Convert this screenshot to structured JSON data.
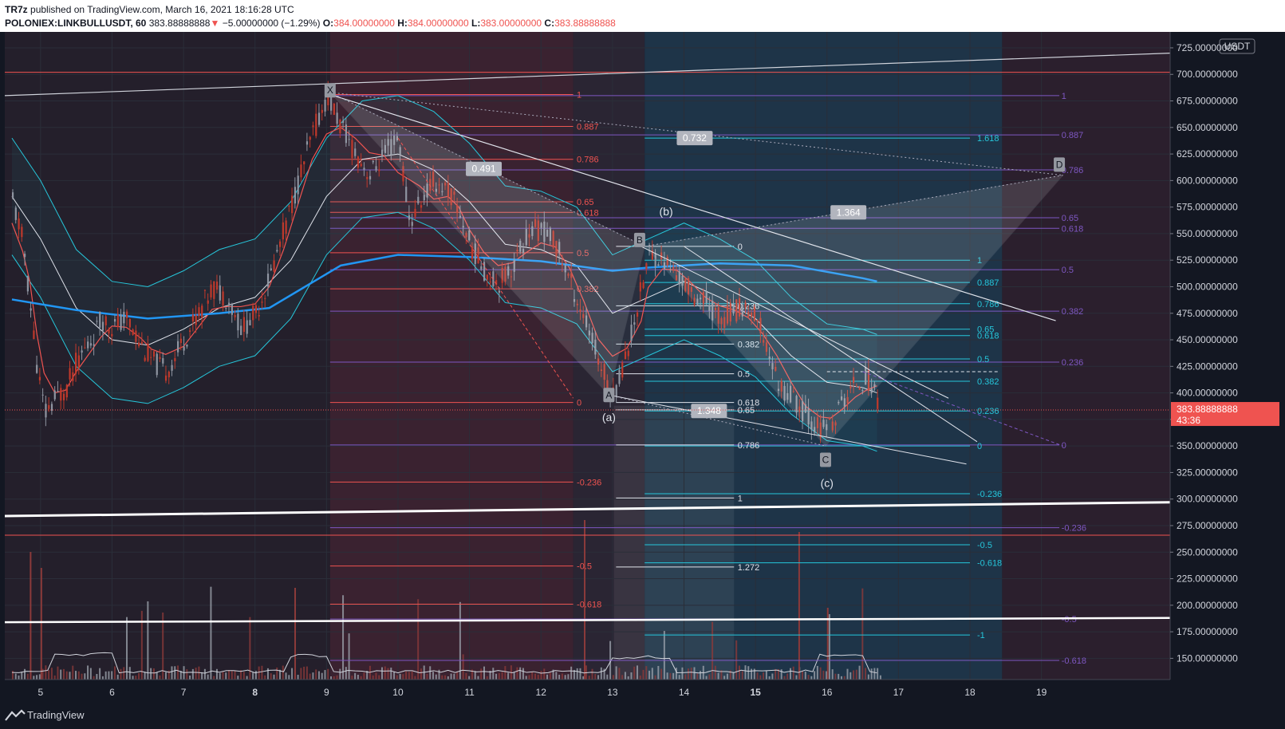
{
  "header": {
    "author": "TR7z",
    "published_text": "published on TradingView.com, March 16, 2021 18:16:28 UTC",
    "symbol": "POLONIEX:LINKBULLUSDT, 60",
    "last": "383.88888888",
    "change_arrow": "▼",
    "change": "−5.00000000 (−1.29%)",
    "o_label": "O:",
    "o": "384.00000000",
    "h_label": "H:",
    "h": "384.00000000",
    "l_label": "L:",
    "l": "383.00000000",
    "c_label": "C:",
    "c": "383.88888888"
  },
  "footer": {
    "brand": "TradingView"
  },
  "colors": {
    "bg": "#131722",
    "up": "#8f95a1",
    "down": "#c0392b",
    "ma": "#2196f3",
    "bb": "#26c6da",
    "red_fib": "#ef5350",
    "purple_fib": "#7e57c2",
    "cyan_fib": "#26c6da"
  },
  "chart_data": {
    "type": "candlestick",
    "currency": "USDT",
    "ylim": [
      130,
      740
    ],
    "y_ticks": [
      "725.00000000",
      "700.00000000",
      "675.00000000",
      "650.00000000",
      "625.00000000",
      "600.00000000",
      "575.00000000",
      "550.00000000",
      "525.00000000",
      "500.00000000",
      "475.00000000",
      "450.00000000",
      "425.00000000",
      "400.00000000",
      "375.00000000",
      "350.00000000",
      "325.00000000",
      "300.00000000",
      "275.00000000",
      "250.00000000",
      "225.00000000",
      "200.00000000",
      "175.00000000",
      "150.00000000"
    ],
    "x_ticks": [
      "5",
      "6",
      "7",
      "8",
      "9",
      "10",
      "11",
      "12",
      "13",
      "14",
      "15",
      "16",
      "17",
      "18",
      "19"
    ],
    "x_tick_bold": [
      "8",
      "15"
    ],
    "last_price": "383.88888888",
    "countdown": "43:36",
    "price_path": [
      [
        4.6,
        580
      ],
      [
        4.75,
        540
      ],
      [
        4.85,
        480
      ],
      [
        4.95,
        420
      ],
      [
        5.05,
        380
      ],
      [
        5.2,
        395
      ],
      [
        5.35,
        405
      ],
      [
        5.5,
        430
      ],
      [
        5.7,
        450
      ],
      [
        5.85,
        470
      ],
      [
        6.0,
        462
      ],
      [
        6.2,
        470
      ],
      [
        6.4,
        445
      ],
      [
        6.55,
        430
      ],
      [
        6.75,
        420
      ],
      [
        7.0,
        450
      ],
      [
        7.2,
        475
      ],
      [
        7.4,
        500
      ],
      [
        7.6,
        490
      ],
      [
        7.8,
        460
      ],
      [
        8.0,
        475
      ],
      [
        8.2,
        510
      ],
      [
        8.4,
        555
      ],
      [
        8.6,
        600
      ],
      [
        8.8,
        645
      ],
      [
        9.0,
        680
      ],
      [
        9.2,
        650
      ],
      [
        9.4,
        625
      ],
      [
        9.6,
        605
      ],
      [
        9.8,
        625
      ],
      [
        10.0,
        640
      ],
      [
        10.15,
        560
      ],
      [
        10.3,
        580
      ],
      [
        10.5,
        600
      ],
      [
        10.7,
        590
      ],
      [
        10.85,
        570
      ],
      [
        11.0,
        540
      ],
      [
        11.2,
        515
      ],
      [
        11.4,
        505
      ],
      [
        11.6,
        520
      ],
      [
        11.8,
        550
      ],
      [
        12.0,
        555
      ],
      [
        12.2,
        540
      ],
      [
        12.4,
        505
      ],
      [
        12.6,
        470
      ],
      [
        12.8,
        430
      ],
      [
        13.0,
        398
      ],
      [
        13.2,
        440
      ],
      [
        13.4,
        500
      ],
      [
        13.5,
        532
      ],
      [
        13.7,
        525
      ],
      [
        13.9,
        510
      ],
      [
        14.1,
        495
      ],
      [
        14.3,
        485
      ],
      [
        14.5,
        470
      ],
      [
        14.7,
        478
      ],
      [
        14.9,
        480
      ],
      [
        15.1,
        455
      ],
      [
        15.3,
        410
      ],
      [
        15.5,
        395
      ],
      [
        15.7,
        380
      ],
      [
        15.9,
        365
      ],
      [
        16.05,
        370
      ],
      [
        16.2,
        390
      ],
      [
        16.4,
        410
      ],
      [
        16.55,
        415
      ],
      [
        16.7,
        395
      ]
    ],
    "bb_center": [
      [
        4.6,
        585
      ],
      [
        5.0,
        545
      ],
      [
        5.5,
        480
      ],
      [
        6.0,
        450
      ],
      [
        6.5,
        445
      ],
      [
        7.0,
        460
      ],
      [
        7.5,
        480
      ],
      [
        8.0,
        490
      ],
      [
        8.5,
        525
      ],
      [
        9.0,
        585
      ],
      [
        9.5,
        620
      ],
      [
        10.0,
        625
      ],
      [
        10.5,
        610
      ],
      [
        11.0,
        580
      ],
      [
        11.5,
        540
      ],
      [
        12.0,
        535
      ],
      [
        12.5,
        520
      ],
      [
        13.0,
        475
      ],
      [
        13.5,
        490
      ],
      [
        14.0,
        505
      ],
      [
        14.5,
        490
      ],
      [
        15.0,
        470
      ],
      [
        15.5,
        435
      ],
      [
        16.0,
        410
      ],
      [
        16.5,
        405
      ],
      [
        16.7,
        400
      ]
    ],
    "bb_width": 55,
    "ma_line": [
      [
        4.6,
        488
      ],
      [
        5.5,
        478
      ],
      [
        6.5,
        470
      ],
      [
        7.5,
        475
      ],
      [
        8.2,
        480
      ],
      [
        8.7,
        500
      ],
      [
        9.2,
        520
      ],
      [
        10.0,
        530
      ],
      [
        11.0,
        528
      ],
      [
        12.0,
        524
      ],
      [
        13.0,
        515
      ],
      [
        13.5,
        518
      ],
      [
        14.5,
        522
      ],
      [
        15.5,
        520
      ],
      [
        16.5,
        508
      ],
      [
        16.7,
        505
      ]
    ],
    "volume": {
      "max_label_value": 260
    },
    "labels": [
      {
        "text": "X",
        "x": 9.05,
        "y": 685,
        "type": "box"
      },
      {
        "text": "A",
        "x": 12.95,
        "y": 398,
        "type": "box"
      },
      {
        "text": "B",
        "x": 13.38,
        "y": 544,
        "type": "box"
      },
      {
        "text": "C",
        "x": 15.98,
        "y": 337,
        "type": "box"
      },
      {
        "text": "D",
        "x": 19.25,
        "y": 615,
        "type": "box"
      },
      {
        "text": "(a)",
        "x": 12.95,
        "y": 377,
        "type": "text"
      },
      {
        "text": "(b)",
        "x": 13.75,
        "y": 571,
        "type": "text"
      },
      {
        "text": "(c)",
        "x": 16.0,
        "y": 315,
        "type": "text"
      },
      {
        "text": "0.491",
        "x": 11.2,
        "y": 611,
        "type": "ratio"
      },
      {
        "text": "0.732",
        "x": 14.15,
        "y": 640,
        "type": "ratio"
      },
      {
        "text": "1.364",
        "x": 16.3,
        "y": 570,
        "type": "ratio"
      },
      {
        "text": "1.348",
        "x": 14.35,
        "y": 383,
        "type": "ratio"
      }
    ],
    "fib_red": [
      {
        "label": "1",
        "value": 681
      },
      {
        "label": "0.887",
        "value": 651
      },
      {
        "label": "0.786",
        "value": 620
      },
      {
        "label": "0.65",
        "value": 580
      },
      {
        "label": "0.618",
        "value": 570
      },
      {
        "label": "0.5",
        "value": 532
      },
      {
        "label": "0.382",
        "value": 498
      },
      {
        "label": "0",
        "value": 391
      },
      {
        "label": "-0.236",
        "value": 316
      },
      {
        "label": "-0.5",
        "value": 237
      },
      {
        "label": "-0.618",
        "value": 201
      }
    ],
    "fib_white": [
      {
        "label": "0",
        "value": 538
      },
      {
        "label": "0.236",
        "value": 482
      },
      {
        "label": "0.382",
        "value": 446
      },
      {
        "label": "0.5",
        "value": 418
      },
      {
        "label": "0.618",
        "value": 391
      },
      {
        "label": "0.65",
        "value": 384
      },
      {
        "label": "0.786",
        "value": 351
      },
      {
        "label": "1",
        "value": 301
      },
      {
        "label": "1.272",
        "value": 236
      }
    ],
    "fib_cyan": [
      {
        "label": "1.618",
        "value": 640
      },
      {
        "label": "1",
        "value": 525
      },
      {
        "label": "0.887",
        "value": 504
      },
      {
        "label": "0.786",
        "value": 484
      },
      {
        "label": "0.65",
        "value": 460
      },
      {
        "label": "0.618",
        "value": 454
      },
      {
        "label": "0.5",
        "value": 432
      },
      {
        "label": "0.382",
        "value": 411
      },
      {
        "label": "0.236",
        "value": 383
      },
      {
        "label": "0",
        "value": 350
      },
      {
        "label": "-0.236",
        "value": 305
      },
      {
        "label": "-0.5",
        "value": 257
      },
      {
        "label": "-0.618",
        "value": 240
      },
      {
        "label": "-1",
        "value": 172
      }
    ],
    "fib_purple": [
      {
        "label": "1",
        "value": 680
      },
      {
        "label": "0.887",
        "value": 643
      },
      {
        "label": "0.786",
        "value": 610
      },
      {
        "label": "0.65",
        "value": 565
      },
      {
        "label": "0.618",
        "value": 555
      },
      {
        "label": "0.5",
        "value": 516
      },
      {
        "label": "0.382",
        "value": 477
      },
      {
        "label": "0.236",
        "value": 429
      },
      {
        "label": "0",
        "value": 351
      },
      {
        "label": "-0.236",
        "value": 273
      },
      {
        "label": "-0.5",
        "value": 187
      },
      {
        "label": "-0.618",
        "value": 148
      }
    ]
  }
}
